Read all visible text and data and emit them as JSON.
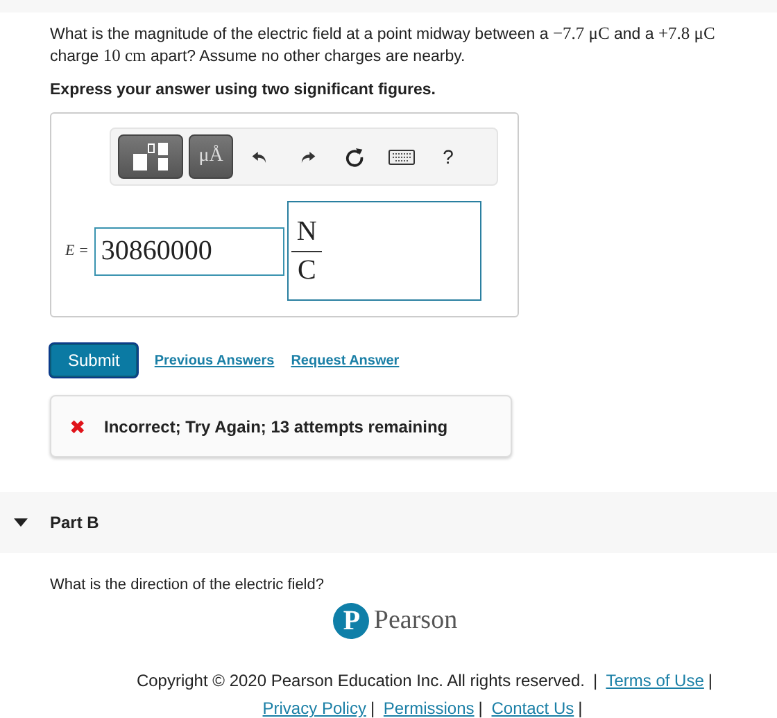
{
  "question": [
    {
      "kind": "text",
      "text": "What is the magnitude of the electric field at a point midway between a "
    },
    {
      "kind": "math",
      "text": "−7.7 μC"
    },
    {
      "kind": "text",
      "text": " and a "
    },
    {
      "kind": "math",
      "text": "+7.8 μC"
    },
    {
      "kind": "text",
      "text": " charge "
    },
    {
      "kind": "math",
      "text": "10 cm"
    },
    {
      "kind": "text",
      "text": " apart? Assume no other charges are nearby."
    }
  ],
  "instruction": "Express your answer using two significant figures.",
  "toolbar": {
    "units_label": "μÅ",
    "help_label": "?"
  },
  "answer": {
    "variable": "E",
    "equals": "=",
    "value": "30860000",
    "unit_numerator": "N",
    "unit_denominator": "C"
  },
  "actions": {
    "submit": "Submit",
    "links": [
      "Previous Answers",
      "Request Answer"
    ]
  },
  "feedback": {
    "icon": "✖",
    "text": "Incorrect; Try Again; 13 attempts remaining"
  },
  "part": {
    "title": "Part B",
    "expanded": true,
    "question": "What is the direction of the electric field?"
  },
  "logo": {
    "mark": "P",
    "name": "Pearson"
  },
  "footer": [
    {
      "kind": "text",
      "text": "Copyright © 2020 Pearson Education Inc. All rights reserved."
    },
    {
      "kind": "sep",
      "text": "|"
    },
    {
      "kind": "link",
      "text": "Terms of Use"
    },
    {
      "kind": "sep",
      "text": "|"
    },
    {
      "kind": "link",
      "text": "Privacy Policy"
    },
    {
      "kind": "sep",
      "text": "|"
    },
    {
      "kind": "link",
      "text": "Permissions"
    },
    {
      "kind": "sep",
      "text": "|"
    },
    {
      "kind": "link",
      "text": "Contact Us"
    },
    {
      "kind": "sep",
      "text": "|"
    }
  ]
}
